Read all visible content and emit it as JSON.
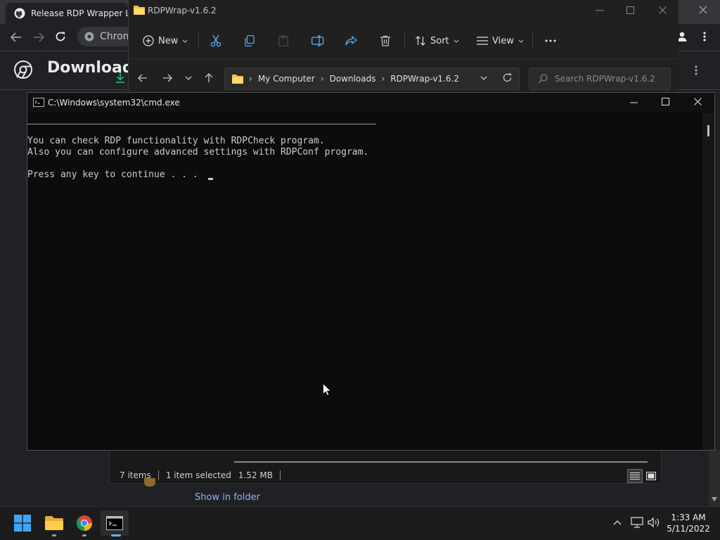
{
  "chrome": {
    "tab_title": "Release RDP Wrapper Libr",
    "omnibox_text": "Chrom",
    "downloads_title": "Downloads",
    "show_in_folder": "Show in folder"
  },
  "explorer": {
    "window_title": "RDPWrap-v1.6.2",
    "toolbar": {
      "new_label": "New",
      "sort_label": "Sort",
      "view_label": "View"
    },
    "breadcrumb": [
      "My Computer",
      "Downloads",
      "RDPWrap-v1.6.2"
    ],
    "search_placeholder": "Search RDPWrap-v1.6.2",
    "status": {
      "items": "7 items",
      "selected": "1 item selected",
      "size": "1.52 MB"
    }
  },
  "cmd": {
    "window_title": "C:\\Windows\\system32\\cmd.exe",
    "lines": [
      "You can check RDP functionality with RDPCheck program.",
      "Also you can configure advanced settings with RDPConf program.",
      "",
      "Press any key to continue . . . "
    ]
  },
  "taskbar": {
    "time": "1:33 AM",
    "date": "5/11/2022"
  },
  "colors": {
    "chrome_bg": "#202124",
    "explorer_bg": "#202020",
    "cmd_bg": "#0c0c0c",
    "link": "#8ab4f8",
    "download_accent": "#1fb36b"
  }
}
